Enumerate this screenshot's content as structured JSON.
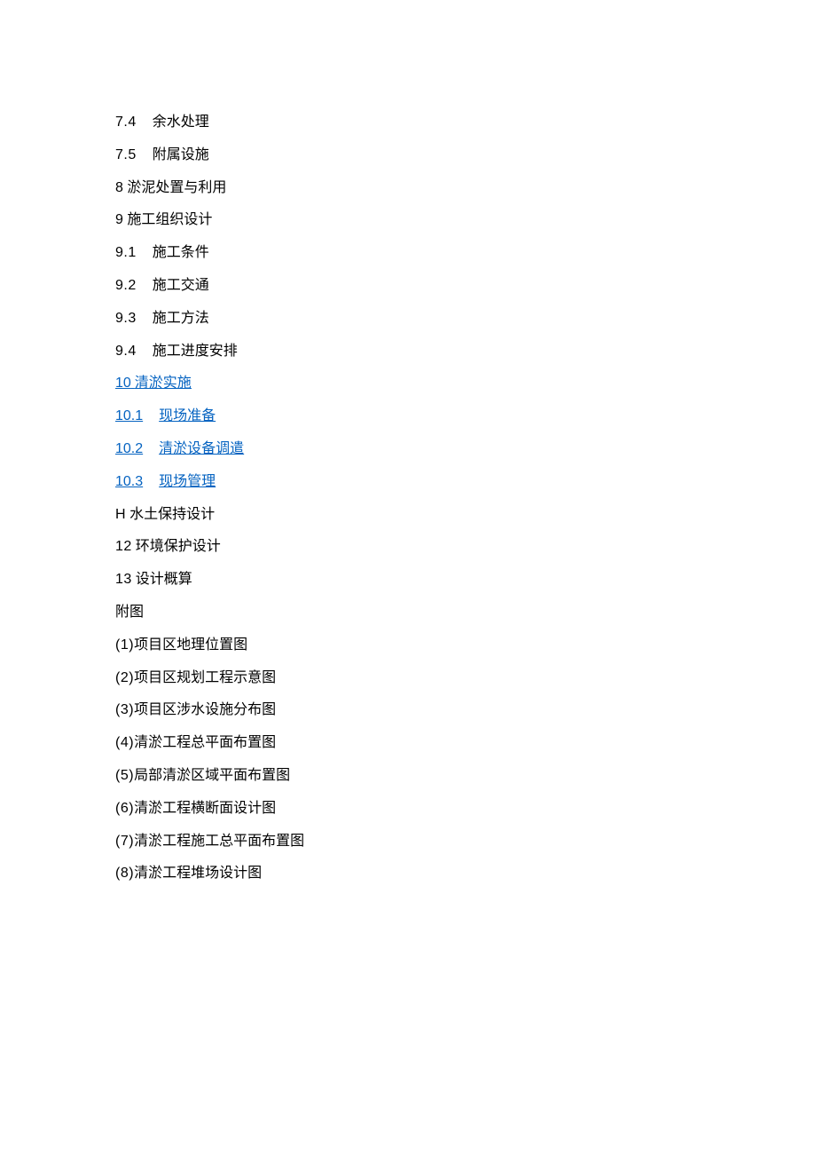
{
  "lines": [
    {
      "type": "sub",
      "num": "7.4",
      "text": "余水处理"
    },
    {
      "type": "sub",
      "num": "7.5",
      "text": "附属设施"
    },
    {
      "type": "top",
      "num": "8",
      "text": "淤泥处置与利用"
    },
    {
      "type": "top",
      "num": "9",
      "text": "施工组织设计"
    },
    {
      "type": "sub",
      "num": "9.1",
      "text": "施工条件"
    },
    {
      "type": "sub",
      "num": "9.2",
      "text": "施工交通"
    },
    {
      "type": "sub",
      "num": "9.3",
      "text": "施工方法"
    },
    {
      "type": "sub",
      "num": "9.4",
      "text": "施工进度安排"
    },
    {
      "type": "linktop",
      "num": "10",
      "text": "清淤实施"
    },
    {
      "type": "linksub",
      "num": "10.1",
      "text": "现场准备"
    },
    {
      "type": "linksub",
      "num": "10.2",
      "text": "清淤设备调遣"
    },
    {
      "type": "linksub",
      "num": "10.3",
      "text": "现场管理"
    },
    {
      "type": "top",
      "num": "H",
      "text": "水土保持设计"
    },
    {
      "type": "top",
      "num": "12",
      "text": "环境保护设计"
    },
    {
      "type": "top",
      "num": "13",
      "text": "设计概算"
    },
    {
      "type": "plain",
      "text": "附图"
    },
    {
      "type": "paren",
      "num": "(1)",
      "text": "项目区地理位置图"
    },
    {
      "type": "paren",
      "num": "(2)",
      "text": "项目区规划工程示意图"
    },
    {
      "type": "paren",
      "num": "(3)",
      "text": "项目区涉水设施分布图"
    },
    {
      "type": "paren",
      "num": "(4)",
      "text": "清淤工程总平面布置图"
    },
    {
      "type": "paren",
      "num": "(5)",
      "text": "局部清淤区域平面布置图"
    },
    {
      "type": "paren",
      "num": "(6)",
      "text": "清淤工程横断面设计图"
    },
    {
      "type": "paren",
      "num": "(7)",
      "text": "清淤工程施工总平面布置图"
    },
    {
      "type": "paren",
      "num": "(8)",
      "text": "清淤工程堆场设计图"
    }
  ]
}
